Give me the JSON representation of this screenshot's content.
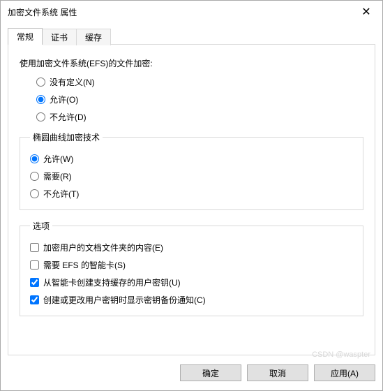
{
  "window": {
    "title": "加密文件系统 属性"
  },
  "tabs": {
    "general": "常规",
    "certificate": "证书",
    "cache": "缓存"
  },
  "efs": {
    "heading": "使用加密文件系统(EFS)的文件加密:",
    "options": {
      "undefined": "没有定义(N)",
      "allow": "允许(O)",
      "deny": "不允许(D)"
    }
  },
  "ecc": {
    "legend": "椭圆曲线加密技术",
    "options": {
      "allow": "允许(W)",
      "require": "需要(R)",
      "deny": "不允许(T)"
    }
  },
  "opts": {
    "legend": "选项",
    "encrypt_docs": "加密用户的文档文件夹的内容(E)",
    "require_smartcard": "需要 EFS 的智能卡(S)",
    "cache_key": "从智能卡创建支持缓存的用户密钥(U)",
    "backup_notify": "创建或更改用户密钥时显示密钥备份通知(C)"
  },
  "buttons": {
    "ok": "确定",
    "cancel": "取消",
    "apply": "应用(A)"
  },
  "watermark": "CSDN @waspter"
}
